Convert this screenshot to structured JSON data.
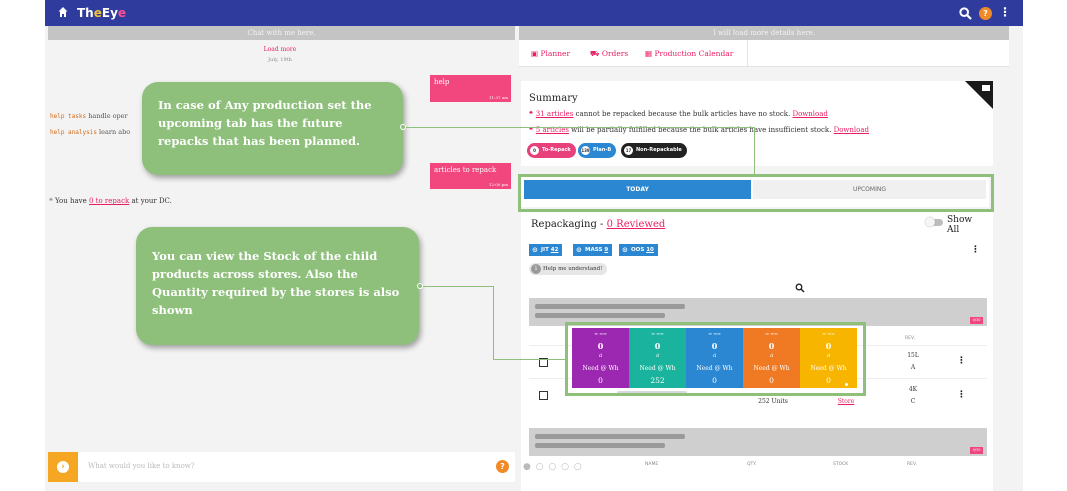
{
  "app": {
    "brand_a": "Th",
    "brand_b": "e",
    "brand_c": "Ey",
    "brand_d": "e"
  },
  "colors": {
    "topbar": "#2f3c9d",
    "accent_pink": "#e91e63",
    "bubble_pink": "#f2467f",
    "callout_green": "#8ec07c",
    "today_blue": "#2b87d1",
    "chat_orange": "#f5a623",
    "help_orange": "#f08a26"
  },
  "icons": {
    "home": "home-icon",
    "search": "search-icon",
    "help": "help-icon",
    "more": "more-vertical-icon"
  },
  "chat": {
    "header": "Chat with me here.",
    "load_more": "Load more",
    "date": "July, 19th",
    "bubbles": [
      {
        "text": "help",
        "time": "11:37 am"
      },
      {
        "text": "articles to repack",
        "time": "12:00 pm"
      }
    ],
    "help_lines": [
      {
        "cmd": "help tasks",
        "text": "handle oper"
      },
      {
        "cmd": "help analysis",
        "text": "learn abo"
      }
    ],
    "have_quote": "❝",
    "have_pre": "You have",
    "have_link": "0 to repack",
    "have_post": "at your DC.",
    "input_placeholder": "What would you like to know?"
  },
  "details": {
    "header": "I will load more details here.",
    "tabs": [
      "Planner",
      "Orders",
      "Production Calendar"
    ]
  },
  "summary": {
    "title": "Summary",
    "line1_link": "31 articles",
    "line1_text": "cannot be repacked because the bulk articles have no stock.",
    "line1_dl": "Download",
    "line2_link": "5 articles",
    "line2_text": "will be partially fulfilled because the bulk articles have insufficient stock.",
    "line2_dl": "Download",
    "chips": [
      {
        "icon": "0",
        "label": "To-Repack"
      },
      {
        "icon": "139",
        "label": "Plan-B"
      },
      {
        "icon": "17",
        "label": "Non-Repackable"
      }
    ]
  },
  "toggle": {
    "today": "TODAY",
    "upcoming": "UPCOMING"
  },
  "repack": {
    "title": "Repackaging -",
    "reviewed": "0 Reviewed",
    "show_all": "Show All",
    "badges": [
      {
        "label": "JIT",
        "count": "42"
      },
      {
        "label": "MASS",
        "count": "9"
      },
      {
        "label": "OOS",
        "count": "10"
      }
    ],
    "help_me": "Help me understand!",
    "rev_head": "REV.",
    "rows": [
      {
        "rev": "15L",
        "grade": "A"
      },
      {
        "qty": "252 Units",
        "rev": "4K",
        "grade": "C",
        "store": "Store"
      }
    ],
    "pill": "0/30",
    "bottom_cols": [
      "NAME",
      "QTY.",
      "STOCK",
      "REV."
    ]
  },
  "stock_strip": [
    {
      "color": "#9c27b0",
      "value": "0",
      "unit": "d",
      "need_label": "Need @ Wh",
      "need": "0"
    },
    {
      "color": "#1ab39e",
      "value": "0",
      "unit": "d",
      "need_label": "Need @ Wh",
      "need": "252"
    },
    {
      "color": "#2b87d1",
      "value": "0",
      "unit": "d",
      "need_label": "Need @ Wh",
      "need": "0"
    },
    {
      "color": "#f07a23",
      "value": "0",
      "unit": "d",
      "need_label": "Need @ Wh",
      "need": "0"
    },
    {
      "color": "#f7b500",
      "value": "0",
      "unit": "d",
      "need_label": "Need @ Wh",
      "need": "0"
    }
  ],
  "callouts": {
    "upcoming": "In case of Any production set the upcoming tab has the future repacks that has been planned.",
    "stock": "You can view the Stock of the child products across stores. Also the Quantity required by the stores is also shown"
  }
}
